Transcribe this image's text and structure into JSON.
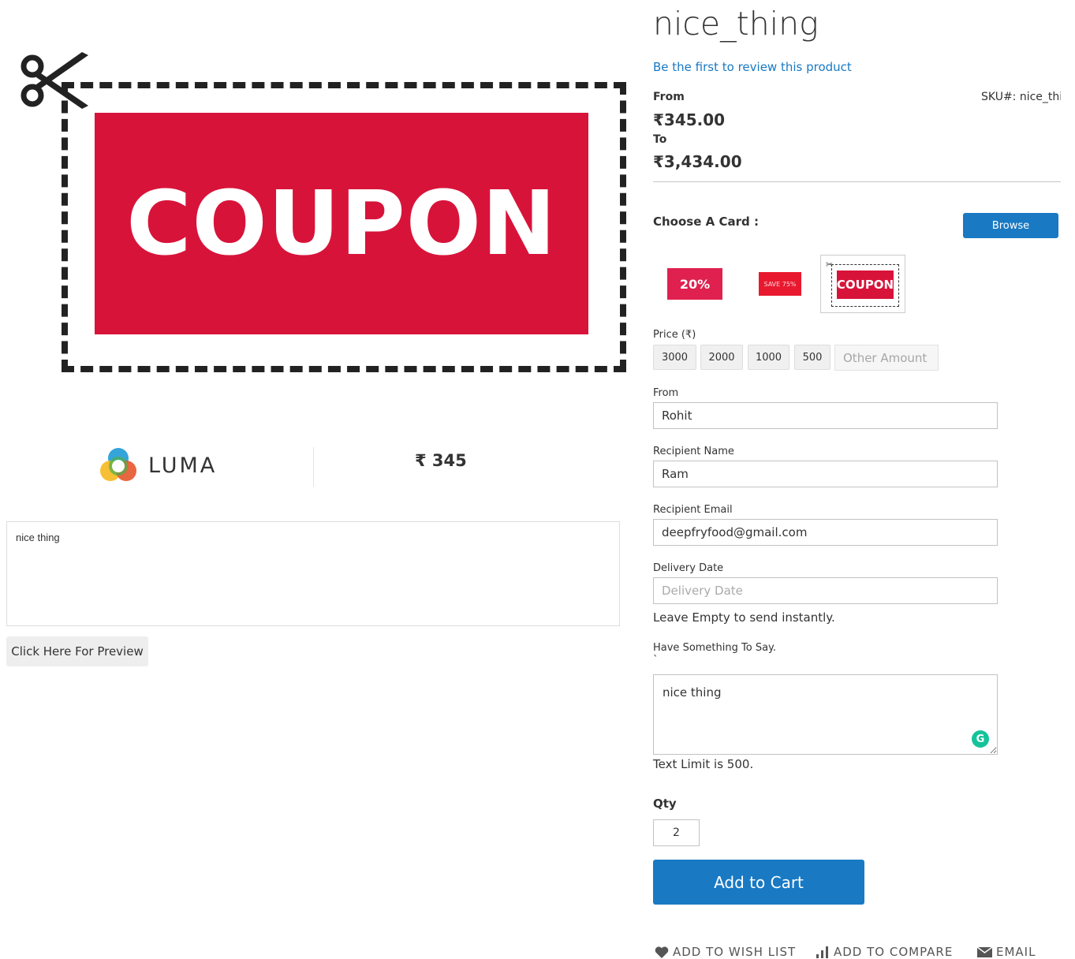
{
  "left": {
    "hero_text": "COUPON",
    "brand_name": "LUMA",
    "price_preview": "₹ 345",
    "message_preview": "nice thing",
    "preview_button": "Click Here For Preview"
  },
  "product": {
    "title": "nice_thing",
    "review_link": "Be the first to review this product",
    "from_label": "From",
    "from_price": "₹345.00",
    "to_label": "To",
    "to_price": "₹3,434.00",
    "sku": "SKU#:  nice_thing"
  },
  "card_chooser": {
    "label": "Choose A Card :",
    "browse_label": "Browse",
    "thumbs": [
      {
        "text": "20%"
      },
      {
        "text": "SAVE 75%"
      },
      {
        "text": "COUPON"
      }
    ]
  },
  "price_field": {
    "label": "Price (₹)",
    "amounts": [
      "3000",
      "2000",
      "1000",
      "500"
    ],
    "other_placeholder": "Other Amount"
  },
  "form": {
    "from_label": "From",
    "from_value": "Rohit",
    "recipient_name_label": "Recipient Name",
    "recipient_name_value": "Ram",
    "recipient_email_label": "Recipient Email",
    "recipient_email_value": "deepfryfood@gmail.com",
    "delivery_date_label": "Delivery Date",
    "delivery_date_placeholder": "Delivery Date",
    "delivery_hint": "Leave Empty to send instantly.",
    "message_label": "Have Something To Say.",
    "message_label_tick": "`",
    "message_value": "nice thing",
    "text_limit": "Text Limit is 500."
  },
  "qty": {
    "label": "Qty",
    "value": "2"
  },
  "add_to_cart": "Add to Cart",
  "actions": {
    "wishlist": "ADD TO WISH LIST",
    "compare": "ADD TO COMPARE",
    "email": "EMAIL"
  },
  "colors": {
    "primary": "#1979c3",
    "coupon_red": "#d8133a",
    "grammarly": "#15c39a"
  }
}
